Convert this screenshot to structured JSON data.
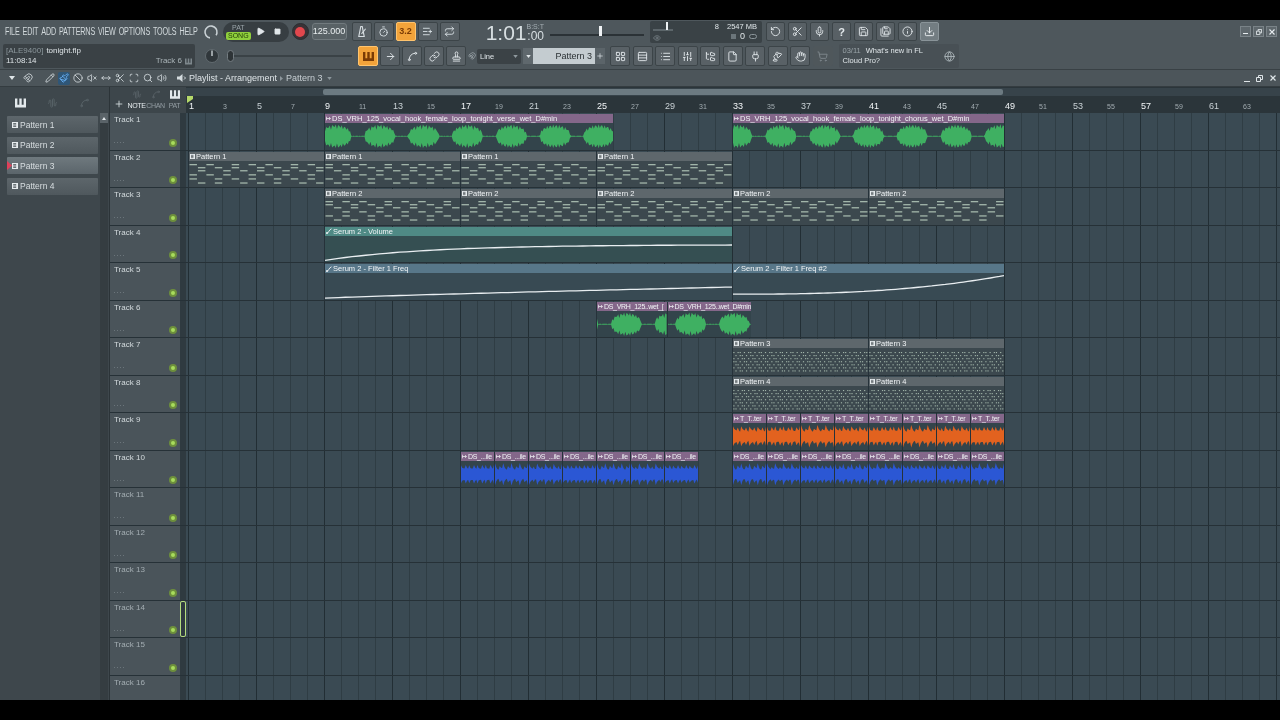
{
  "menu": [
    "FILE",
    "EDIT",
    "ADD",
    "PATTERNS",
    "VIEW",
    "OPTIONS",
    "TOOLS",
    "HELP"
  ],
  "transport": {
    "modes": [
      {
        "label": "PAT",
        "selected": false
      },
      {
        "label": "SONG",
        "selected": true
      }
    ],
    "tempo": "125.000"
  },
  "record_options": [
    {
      "kind": "metronome",
      "on": false
    },
    {
      "kind": "wait",
      "on": false
    },
    {
      "kind": "countdown",
      "label": "3.2",
      "on": true
    },
    {
      "kind": "step",
      "on": false
    },
    {
      "kind": "blend",
      "on": false
    }
  ],
  "time_display": {
    "caption": "B:S:T",
    "main": "1:01",
    "sub": ":00"
  },
  "master": {
    "level": 0.54
  },
  "monitor": {
    "polyphony": "8",
    "memory": "2547 MB",
    "cpu": "0"
  },
  "window_tools": [
    {
      "kind": "undo",
      "on": false
    },
    {
      "kind": "cut",
      "on": false
    },
    {
      "kind": "mic",
      "on": false
    },
    {
      "kind": "help",
      "label": "?",
      "on": false
    },
    {
      "kind": "save",
      "on": false
    },
    {
      "kind": "save-as",
      "on": false
    },
    {
      "kind": "info",
      "on": false
    },
    {
      "kind": "export",
      "on": true
    }
  ],
  "song_info": {
    "user": "[ALE9400]",
    "file": "tonight.flp",
    "clock": "11:08:14",
    "hint": "Track 6"
  },
  "pitch": {
    "level": 0
  },
  "view_tools": [
    {
      "kind": "playlist",
      "on": true
    },
    {
      "kind": "arrow",
      "on": false
    },
    {
      "kind": "curve",
      "on": false
    },
    {
      "kind": "link",
      "on": false
    },
    {
      "kind": "stamp",
      "on": false
    }
  ],
  "snap": {
    "value": "Line"
  },
  "pattern_selector": {
    "value": "Pattern 3"
  },
  "panels": [
    {
      "kind": "channels",
      "disabled": false
    },
    {
      "kind": "steps",
      "disabled": false
    },
    {
      "kind": "list",
      "disabled": false
    },
    {
      "kind": "mixer",
      "disabled": false
    },
    {
      "kind": "browser",
      "disabled": false
    },
    {
      "kind": "file",
      "disabled": false
    },
    {
      "kind": "plugin",
      "disabled": false
    },
    {
      "kind": "lamp",
      "disabled": false
    },
    {
      "kind": "hand",
      "disabled": false
    },
    {
      "kind": "cart",
      "disabled": true
    }
  ],
  "news": {
    "date": "03/11",
    "headline": "What's new in FL Cloud Pro?"
  },
  "playlist": {
    "title": "Playlist - Arrangement",
    "pattern": "Pattern 3",
    "tools": [
      {
        "kind": "snap",
        "selected": false
      },
      {
        "kind": "draw",
        "selected": false
      },
      {
        "kind": "paint",
        "selected": true
      },
      {
        "kind": "delete",
        "selected": false
      },
      {
        "kind": "mute",
        "selected": false
      },
      {
        "kind": "slip",
        "selected": false
      },
      {
        "kind": "slice",
        "selected": false
      },
      {
        "kind": "select",
        "selected": false
      },
      {
        "kind": "zoom",
        "selected": false
      },
      {
        "kind": "playback",
        "selected": false
      }
    ]
  },
  "picker": {
    "filters": [
      {
        "kind": "patterns",
        "on": true
      },
      {
        "kind": "audio",
        "on": false
      },
      {
        "kind": "automation",
        "on": false
      }
    ],
    "items": [
      {
        "label": "Pattern 1",
        "selected": false
      },
      {
        "label": "Pattern 2",
        "selected": false
      },
      {
        "label": "Pattern 3",
        "selected": true
      },
      {
        "label": "Pattern 4",
        "selected": false
      }
    ]
  },
  "ruler_tools": {
    "icons": [
      {
        "kind": "audio",
        "on": false
      },
      {
        "kind": "automation",
        "on": false
      },
      {
        "kind": "patterns",
        "on": true
      }
    ],
    "modes": [
      {
        "label": "NOTE",
        "selected": true
      },
      {
        "label": "CHAN",
        "selected": false
      },
      {
        "label": "PAT",
        "selected": false
      }
    ]
  },
  "ruler": [
    "1",
    "3",
    "5",
    "7",
    "9",
    "11",
    "13",
    "15",
    "17",
    "19",
    "21",
    "23",
    "25",
    "27",
    "29",
    "31",
    "33",
    "35",
    "37",
    "39",
    "41",
    "43",
    "45",
    "47",
    "49",
    "51",
    "53",
    "55",
    "57",
    "59",
    "61",
    "63"
  ],
  "tracks": [
    {
      "name": "Track 1",
      "on": true,
      "selected": false,
      "clips": [
        {
          "kind": "audio",
          "name": "DS_VRH_125_vocal_hook_female_loop_tonight_verse_wet_D#min",
          "color": "#3fb062"
        },
        {
          "kind": "audio",
          "name": "DS_VRH_125_vocal_hook_female_loop_tonight_chorus_wet_D#min",
          "color": "#3fb062"
        }
      ]
    },
    {
      "name": "Track 2",
      "on": true,
      "selected": false,
      "clips": [
        {
          "kind": "pattern",
          "name": "Pattern 1"
        },
        {
          "kind": "pattern",
          "name": "Pattern 1"
        },
        {
          "kind": "pattern",
          "name": "Pattern 1"
        },
        {
          "kind": "pattern",
          "name": "Pattern 1"
        }
      ]
    },
    {
      "name": "Track 3",
      "on": true,
      "selected": false,
      "clips": [
        {
          "kind": "pattern",
          "name": "Pattern 2"
        },
        {
          "kind": "pattern",
          "name": "Pattern 2"
        },
        {
          "kind": "pattern",
          "name": "Pattern 2"
        },
        {
          "kind": "pattern",
          "name": "Pattern 2"
        },
        {
          "kind": "pattern",
          "name": "Pattern 2"
        }
      ]
    },
    {
      "name": "Track 4",
      "on": true,
      "selected": false,
      "clips": [
        {
          "kind": "automation",
          "name": "Serum 2 - Volume",
          "color": "#4f8a85"
        }
      ]
    },
    {
      "name": "Track 5",
      "on": true,
      "selected": false,
      "clips": [
        {
          "kind": "automation",
          "name": "Serum 2 - Filter 1 Freq",
          "color": "#587789"
        },
        {
          "kind": "automation",
          "name": "Serum 2 - Filter 1 Freq #2",
          "color": "#587789"
        }
      ]
    },
    {
      "name": "Track 6",
      "on": true,
      "selected": false,
      "clips": [
        {
          "kind": "audio",
          "name": "DS_VRH_125..wet_[",
          "color": "#3fb062"
        },
        {
          "kind": "audio",
          "name": "DS_VRH_125..wet_D#min",
          "color": "#3fb062"
        }
      ]
    },
    {
      "name": "Track 7",
      "on": true,
      "selected": false,
      "clips": [
        {
          "kind": "pattern",
          "name": "Pattern 3"
        },
        {
          "kind": "pattern",
          "name": "Pattern 3"
        }
      ]
    },
    {
      "name": "Track 8",
      "on": true,
      "selected": false,
      "clips": [
        {
          "kind": "pattern",
          "name": "Pattern 4"
        },
        {
          "kind": "pattern",
          "name": "Pattern 4"
        }
      ]
    },
    {
      "name": "Track 9",
      "on": true,
      "selected": false,
      "clips": [
        {
          "kind": "audio",
          "name": "T_T..ter",
          "color": "#e2621f"
        },
        {
          "kind": "audio",
          "name": "T_T..ter",
          "color": "#e2621f"
        },
        {
          "kind": "audio",
          "name": "T_T..ter",
          "color": "#e2621f"
        },
        {
          "kind": "audio",
          "name": "T_T..ter",
          "color": "#e2621f"
        },
        {
          "kind": "audio",
          "name": "T_T..ter",
          "color": "#e2621f"
        },
        {
          "kind": "audio",
          "name": "T_T..ter",
          "color": "#e2621f"
        },
        {
          "kind": "audio",
          "name": "T_T..ter",
          "color": "#e2621f"
        },
        {
          "kind": "audio",
          "name": "T_T..ter",
          "color": "#e2621f"
        }
      ]
    },
    {
      "name": "Track 10",
      "on": true,
      "selected": false,
      "clips": [
        {
          "kind": "audio",
          "name": "DS_...ile",
          "color": "#2b57d4"
        },
        {
          "kind": "audio",
          "name": "DS_...ile",
          "color": "#2b57d4"
        },
        {
          "kind": "audio",
          "name": "DS_...ile",
          "color": "#2b57d4"
        },
        {
          "kind": "audio",
          "name": "DS_...ile",
          "color": "#2b57d4"
        },
        {
          "kind": "audio",
          "name": "DS_...ile",
          "color": "#2b57d4"
        },
        {
          "kind": "audio",
          "name": "DS_...ile",
          "color": "#2b57d4"
        },
        {
          "kind": "audio",
          "name": "DS_...ile",
          "color": "#2b57d4"
        },
        {
          "kind": "audio",
          "name": "DS_...ile",
          "color": "#2b57d4"
        },
        {
          "kind": "audio",
          "name": "DS_...ile",
          "color": "#2b57d4"
        },
        {
          "kind": "audio",
          "name": "DS_...ile",
          "color": "#2b57d4"
        },
        {
          "kind": "audio",
          "name": "DS_...ile",
          "color": "#2b57d4"
        },
        {
          "kind": "audio",
          "name": "DS_...ile",
          "color": "#2b57d4"
        },
        {
          "kind": "audio",
          "name": "DS_...ile",
          "color": "#2b57d4"
        },
        {
          "kind": "audio",
          "name": "DS_...ile",
          "color": "#2b57d4"
        },
        {
          "kind": "audio",
          "name": "DS_...ile",
          "color": "#2b57d4"
        }
      ]
    },
    {
      "name": "Track 11",
      "on": true,
      "selected": false
    },
    {
      "name": "Track 12",
      "on": true,
      "selected": false
    },
    {
      "name": "Track 13",
      "on": true,
      "selected": false
    },
    {
      "name": "Track 14",
      "on": true,
      "selected": true
    },
    {
      "name": "Track 15",
      "on": true,
      "selected": false
    },
    {
      "name": "Track 16",
      "selected": false
    }
  ]
}
